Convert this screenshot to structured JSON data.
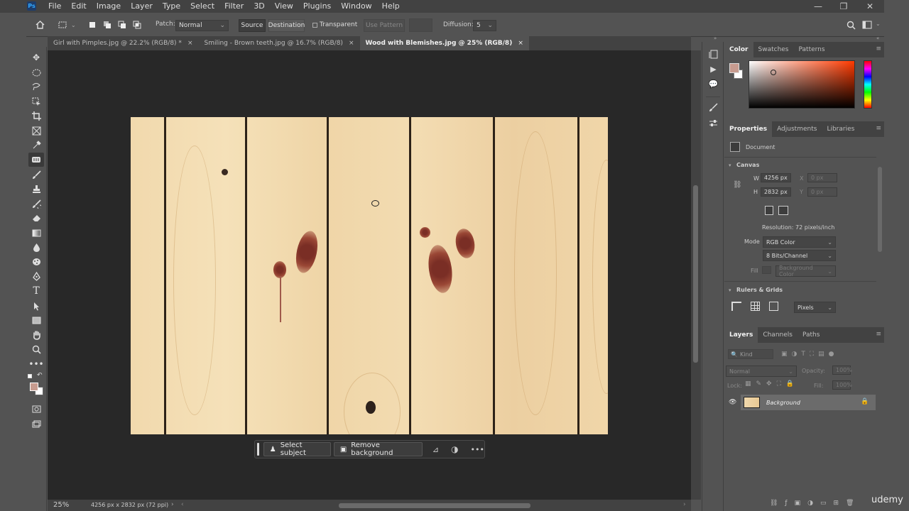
{
  "menubar": {
    "app_icon": "Ps",
    "items": [
      "File",
      "Edit",
      "Image",
      "Layer",
      "Type",
      "Select",
      "Filter",
      "3D",
      "View",
      "Plugins",
      "Window",
      "Help"
    ],
    "window_controls": [
      "—",
      "❐",
      "✕"
    ]
  },
  "options": {
    "patch_label": "Patch:",
    "patch_mode": "Normal",
    "source": "Source",
    "destination": "Destination",
    "transparent": "Transparent",
    "use_pattern": "Use Pattern",
    "diffusion_label": "Diffusion:",
    "diffusion_value": "5"
  },
  "tabs": [
    {
      "label": "Girl with Pimples.jpg @ 22.2% (RGB/8) *",
      "close": "×"
    },
    {
      "label": "Smiling - Brown teeth.jpg @ 16.7% (RGB/8)",
      "close": "×"
    },
    {
      "label": "Wood with Blemishes.jpg @ 25% (RGB/8)",
      "close": "×"
    }
  ],
  "context_bar": {
    "select_subject": "Select subject",
    "remove_background": "Remove background"
  },
  "statusbar": {
    "zoom": "25%",
    "doc_info": "4256 px x 2832 px (72 ppi)"
  },
  "color_panel": {
    "tabs": [
      "Color",
      "Swatches",
      "Patterns"
    ],
    "fg_color": "#c79b8f",
    "bg_color": "#ffffff"
  },
  "properties_panel": {
    "tabs": [
      "Properties",
      "Adjustments",
      "Libraries"
    ],
    "document_label": "Document",
    "canvas_label": "Canvas",
    "w_label": "W",
    "w_value": "4256 px",
    "x_label": "X",
    "x_placeholder": "0 px",
    "h_label": "H",
    "h_value": "2832 px",
    "y_label": "Y",
    "y_placeholder": "0 px",
    "resolution": "Resolution: 72 pixels/inch",
    "mode_label": "Mode",
    "mode_value": "RGB Color",
    "bits_value": "8 Bits/Channel",
    "fill_label": "Fill",
    "fill_value": "Background Color",
    "rulers_label": "Rulers & Grids",
    "units_value": "Pixels"
  },
  "layers_panel": {
    "tabs": [
      "Layers",
      "Channels",
      "Paths"
    ],
    "kind_label": "Kind",
    "blend_mode": "Normal",
    "opacity_label": "Opacity:",
    "opacity_value": "100%",
    "lock_label": "Lock:",
    "fill_label": "Fill:",
    "fill_value": "100%",
    "layer_name": "Background"
  },
  "watermark": "udemy"
}
